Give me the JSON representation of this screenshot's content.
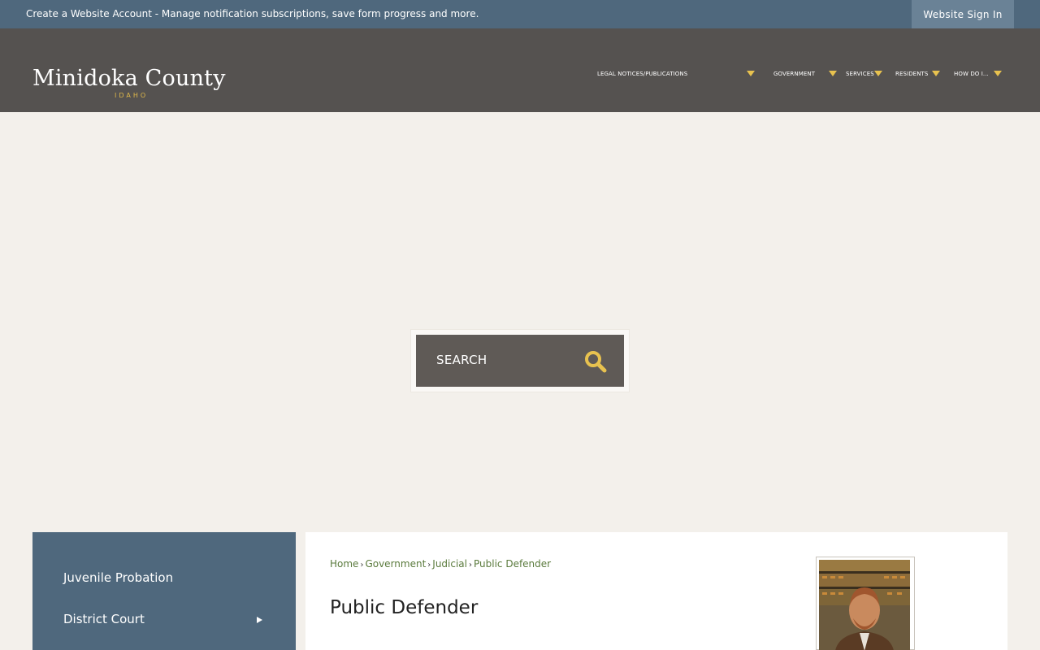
{
  "topbar": {
    "create_account_link": "Create a Website Account",
    "create_account_desc": " - Manage notification subscriptions, save form progress and more.",
    "sign_in": "Website Sign In"
  },
  "header": {
    "logo_name": "Minidoka County",
    "logo_sub": "IDAHO",
    "nav": [
      {
        "label": "Legal Notices/Publications",
        "icon": "chevron-down-icon"
      },
      {
        "label": "Government",
        "icon": "chevron-down-icon"
      },
      {
        "label": "Services",
        "icon": "chevron-down-icon"
      },
      {
        "label": "Residents",
        "icon": "chevron-down-icon"
      },
      {
        "label": "How Do I...",
        "icon": "chevron-down-icon"
      }
    ],
    "accent_color": "#e8c24f"
  },
  "search": {
    "placeholder": "SEARCH",
    "icon": "search-icon"
  },
  "sidenav": {
    "items": [
      {
        "label": "Juvenile Probation",
        "has_submenu": false
      },
      {
        "label": "District Court",
        "has_submenu": true
      }
    ]
  },
  "main": {
    "breadcrumb": [
      "Home",
      "Government",
      "Judicial",
      "Public Defender"
    ],
    "title": "Public Defender"
  }
}
